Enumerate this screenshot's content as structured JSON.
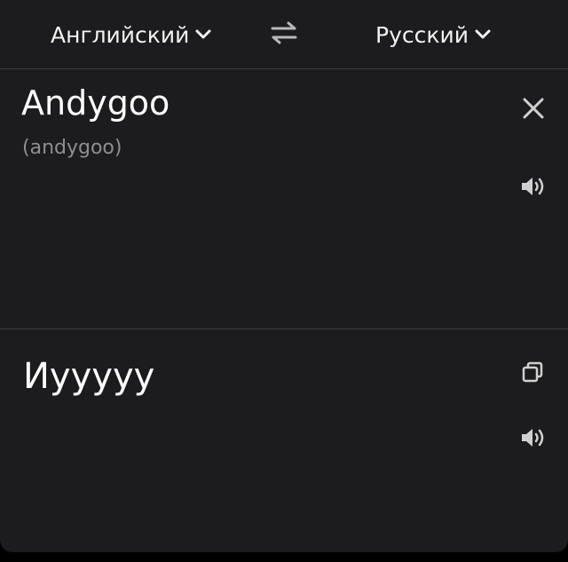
{
  "header": {
    "source_language": "Английский",
    "target_language": "Русский"
  },
  "source": {
    "text": "Andygoo",
    "transliteration": "(andygoo)"
  },
  "target": {
    "text": "Иууууу"
  },
  "icons": {
    "source_chevron": "chevron-down-icon",
    "target_chevron": "chevron-down-icon",
    "swap": "swap-icon",
    "clear": "close-icon",
    "source_speak": "speaker-icon",
    "copy": "copy-icon",
    "target_speak": "speaker-icon"
  },
  "colors": {
    "background": "#1c1c1e",
    "divider": "#3b3b3d",
    "primary_text": "#ffffff",
    "secondary_text": "#8e8e90",
    "icon": "#d0d0d0"
  }
}
